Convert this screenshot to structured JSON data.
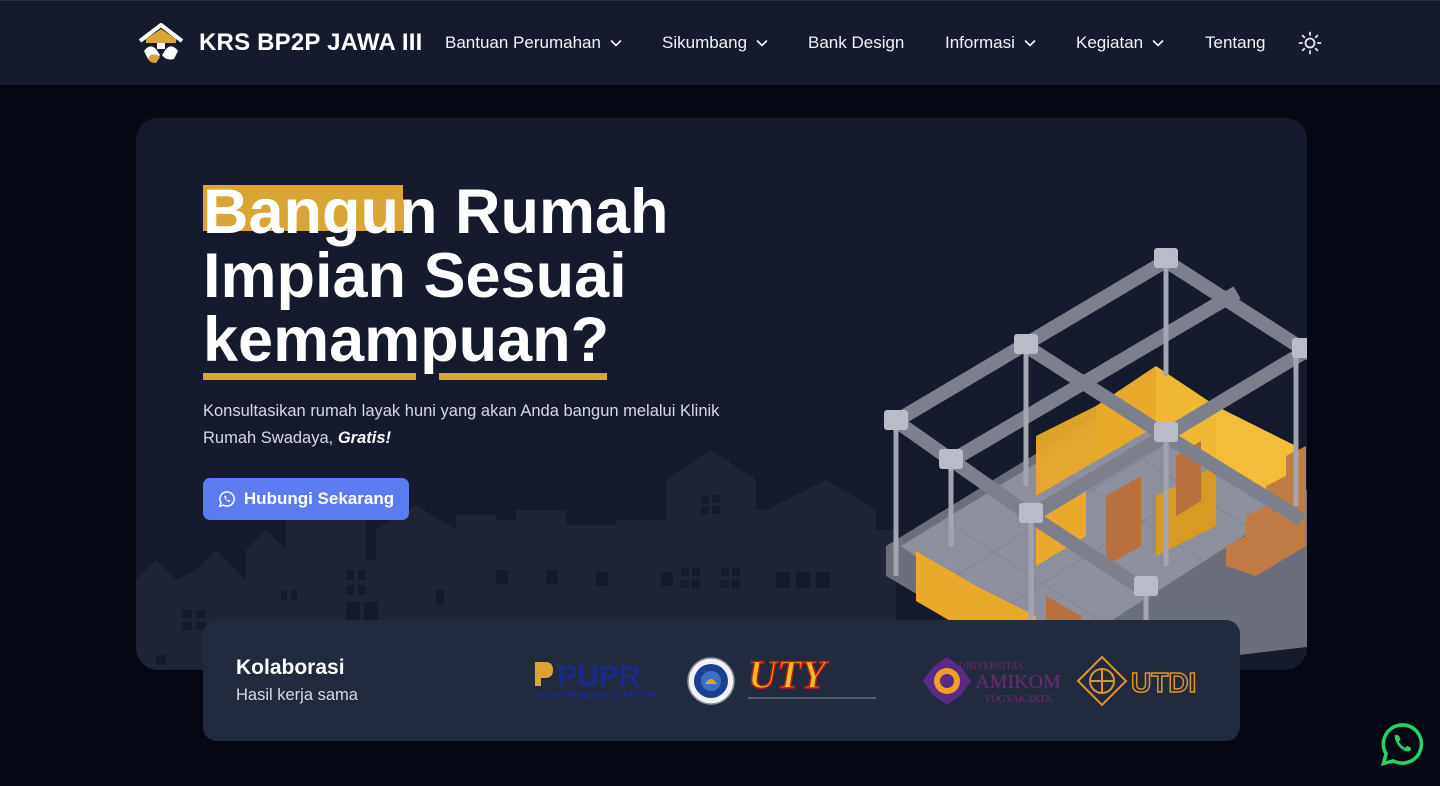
{
  "brand": {
    "name": "KRS BP2P JAWA III",
    "logo_icon": "house-hands-icon"
  },
  "nav": {
    "items": [
      {
        "label": "Bantuan Perumahan",
        "has_dropdown": true
      },
      {
        "label": "Sikumbang",
        "has_dropdown": true
      },
      {
        "label": "Bank Design",
        "has_dropdown": false
      },
      {
        "label": "Informasi",
        "has_dropdown": true
      },
      {
        "label": "Kegiatan",
        "has_dropdown": true
      },
      {
        "label": "Tentang",
        "has_dropdown": false
      }
    ],
    "theme_icon": "sun-icon"
  },
  "hero": {
    "title_highlight": "Bangun",
    "title_line1_rest": " Rumah",
    "title_line2": "Impian Sesuai",
    "title_line3": "kemampuan?",
    "description": "Konsultasikan rumah layak huni yang akan Anda bangun melalui Klinik Rumah Swadaya, ",
    "description_emphasis": "Gratis!",
    "cta_label": "Hubungi Sekarang",
    "cta_icon": "whatsapp-icon"
  },
  "collab": {
    "title": "Kolaborasi",
    "subtitle": "Hasil kerja sama",
    "logos": {
      "pupr": {
        "text": "PUPR",
        "tagline": "SIGAP MEMBANGUN NEGERI"
      },
      "uty": {
        "text": "UTY"
      },
      "amikom": {
        "line1": "UNIVERSITAS",
        "line2": "AMIKOM",
        "line3": "YOGYAKARTA"
      },
      "utdi": {
        "text": "UTDI"
      }
    }
  },
  "colors": {
    "accent_gold": "#d9a636",
    "cta_blue": "#5b7cf0",
    "navbar_bg": "#151a2c",
    "page_bg": "#050713",
    "whatsapp_green": "#25d366"
  }
}
